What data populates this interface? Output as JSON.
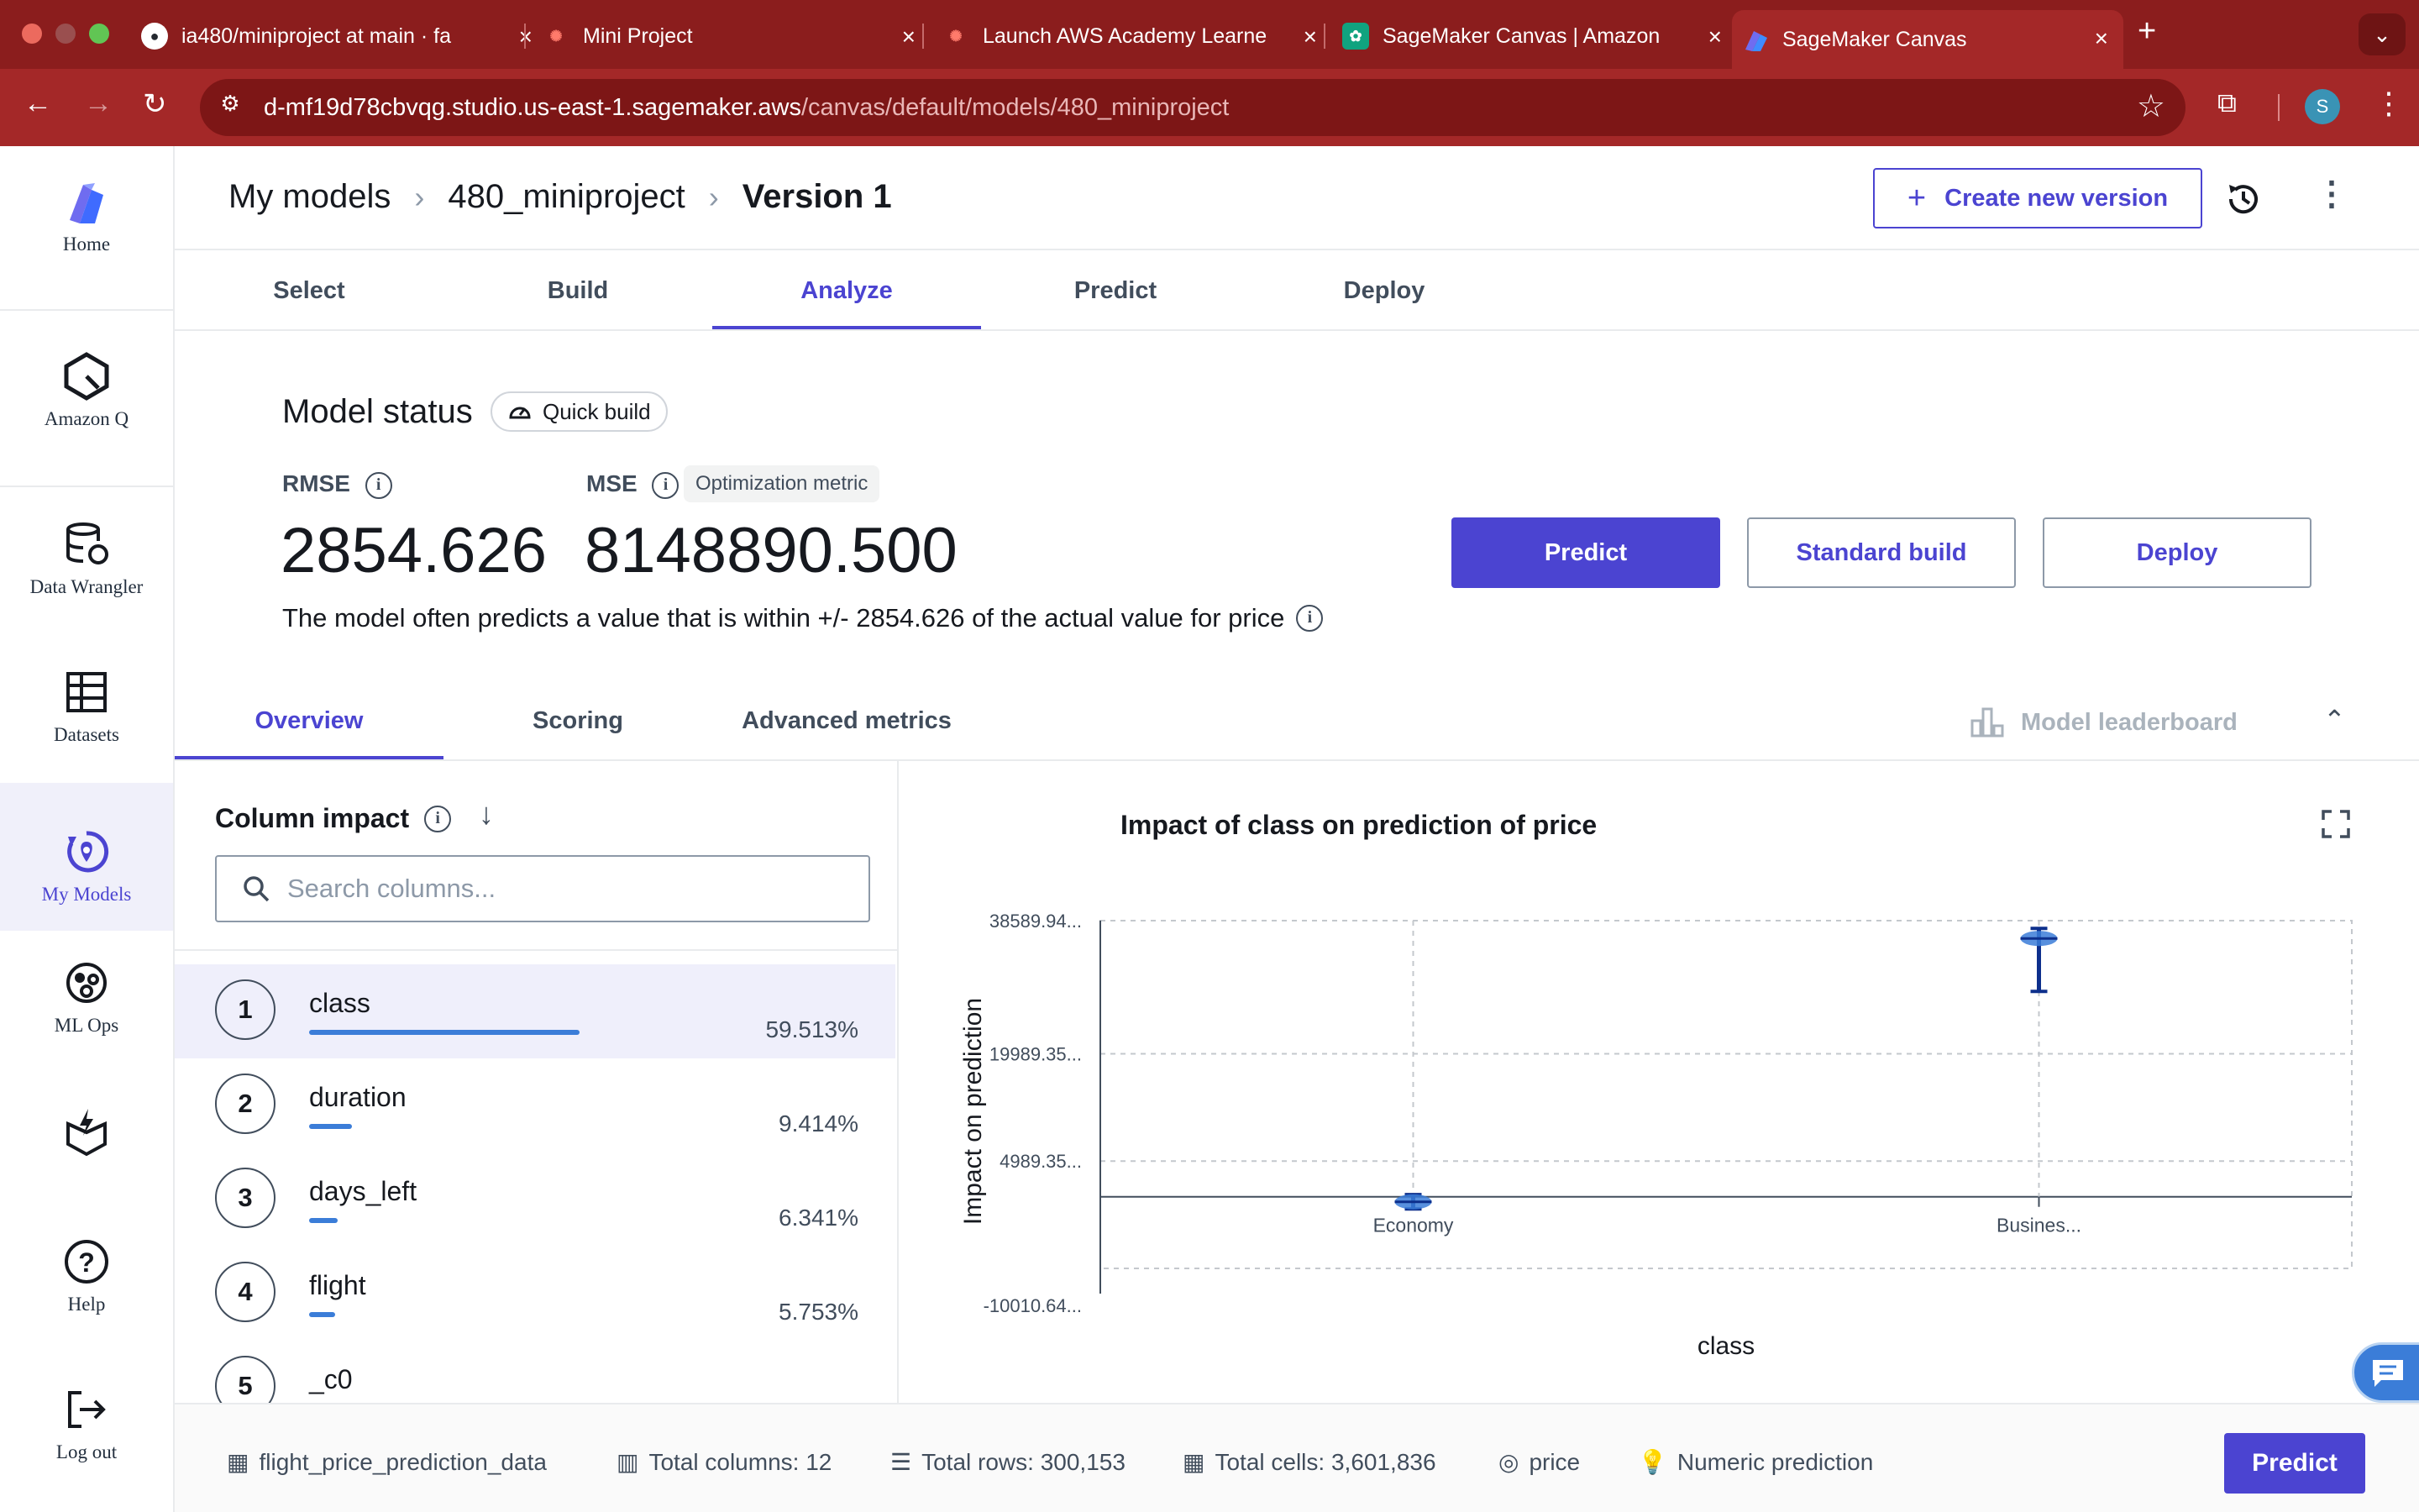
{
  "browser": {
    "tabs": [
      {
        "title": "ia480/miniproject at main · fa",
        "icon": "github-icon"
      },
      {
        "title": "Mini Project",
        "icon": "canvas-lms-icon"
      },
      {
        "title": "Launch AWS Academy Learne",
        "icon": "canvas-lms-icon"
      },
      {
        "title": "SageMaker Canvas | Amazon",
        "icon": "chatgpt-icon"
      },
      {
        "title": "SageMaker Canvas",
        "icon": "sagemaker-canvas-icon"
      }
    ],
    "url_host": "d-mf19d78cbvqg.studio.us-east-1.sagemaker.aws",
    "url_path": "/canvas/default/models/480_miniproject",
    "profile_initial": "S"
  },
  "sidebar": {
    "items": [
      {
        "label": "Home",
        "icon": "canvas-logo-icon"
      },
      {
        "label": "Amazon Q",
        "icon": "amazon-q-icon"
      },
      {
        "label": "Data Wrangler",
        "icon": "data-wrangler-icon"
      },
      {
        "label": "Datasets",
        "icon": "datasets-icon"
      },
      {
        "label": "My Models",
        "icon": "my-models-icon"
      },
      {
        "label": "ML Ops",
        "icon": "ml-ops-icon"
      },
      {
        "label": "",
        "icon": "package-icon"
      },
      {
        "label": "Help",
        "icon": "help-icon"
      },
      {
        "label": "Log out",
        "icon": "logout-icon"
      }
    ]
  },
  "header": {
    "breadcrumbs": [
      "My models",
      "480_miniproject",
      "Version 1"
    ],
    "create_version_label": "Create new version"
  },
  "steps": [
    "Select",
    "Build",
    "Analyze",
    "Predict",
    "Deploy"
  ],
  "active_step": "Analyze",
  "model_status": {
    "title": "Model status",
    "build_type": "Quick build",
    "metrics": [
      {
        "name": "RMSE",
        "value": "2854.626"
      },
      {
        "name": "MSE",
        "value": "8148890.500",
        "badge": "Optimization metric"
      }
    ],
    "description": "The model often predicts a value that is within +/- 2854.626 of the actual value for price",
    "buttons": {
      "predict": "Predict",
      "standard_build": "Standard build",
      "deploy": "Deploy"
    }
  },
  "analysis_tabs": [
    "Overview",
    "Scoring",
    "Advanced metrics"
  ],
  "leaderboard_label": "Model leaderboard",
  "column_impact": {
    "title": "Column impact",
    "search_placeholder": "Search columns...",
    "rows": [
      {
        "rank": "1",
        "name": "class",
        "pct": "59.513%",
        "value": 59.513
      },
      {
        "rank": "2",
        "name": "duration",
        "pct": "9.414%",
        "value": 9.414
      },
      {
        "rank": "3",
        "name": "days_left",
        "pct": "6.341%",
        "value": 6.341
      },
      {
        "rank": "4",
        "name": "flight",
        "pct": "5.753%",
        "value": 5.753
      },
      {
        "rank": "5",
        "name": "_c0",
        "pct": "",
        "value": 0
      }
    ]
  },
  "chart_data": {
    "type": "scatter",
    "title": "Impact of class on prediction of price",
    "xlabel": "class",
    "ylabel": "Impact on prediction",
    "categories": [
      "Economy",
      "Busines..."
    ],
    "y_tick_labels": [
      "38589.94...",
      "19989.35...",
      "4989.35...",
      "-10010.64..."
    ],
    "ylim": [
      -10010.64,
      38589.94
    ],
    "zero_baseline": 0,
    "points": [
      {
        "category": "Economy",
        "median": -700,
        "min": -1700,
        "max": 300
      },
      {
        "category": "Busines...",
        "median": 36100,
        "min": 28700,
        "max": 37500
      }
    ],
    "grid": true
  },
  "footer": {
    "dataset": "flight_price_prediction_data",
    "total_columns": "Total columns: 12",
    "total_rows": "Total rows: 300,153",
    "total_cells": "Total cells: 3,601,836",
    "target": "price",
    "problem_type": "Numeric prediction",
    "predict_label": "Predict"
  }
}
